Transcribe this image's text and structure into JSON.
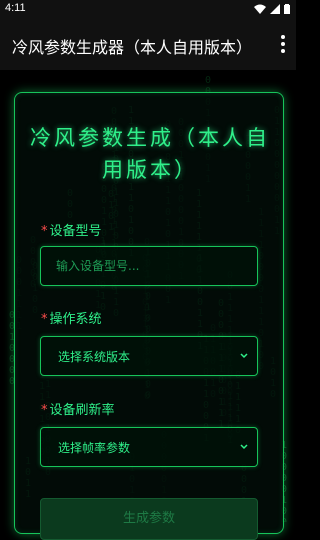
{
  "status_bar": {
    "time": "4:11"
  },
  "app_bar": {
    "title": "冷风参数生成器（本人自用版本）"
  },
  "card": {
    "title": "冷风参数生成（本人自用版本）",
    "fields": [
      {
        "required_mark": "*",
        "label": "设备型号",
        "placeholder": "输入设备型号..."
      },
      {
        "required_mark": "*",
        "label": "操作系统",
        "value": "选择系统版本"
      },
      {
        "required_mark": "*",
        "label": "设备刷新率",
        "value": "选择帧率参数"
      }
    ],
    "submit_label": "生成参数"
  },
  "colors": {
    "accent": "#2ff08a",
    "border": "#17c45a",
    "background": "#000000"
  }
}
